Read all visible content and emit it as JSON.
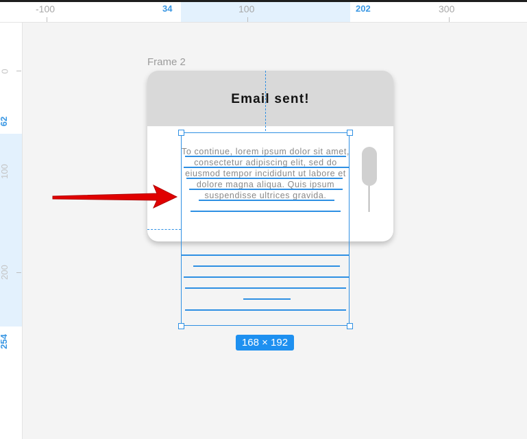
{
  "ruler_top": {
    "ticks": [
      "-100",
      "34",
      "100",
      "202",
      "300"
    ]
  },
  "ruler_left": {
    "ticks": [
      "0",
      "62",
      "100",
      "200",
      "254"
    ]
  },
  "frame": {
    "title": "Frame 2"
  },
  "modal": {
    "heading": "Email sent!",
    "body": "To continue, lorem ipsum dolor sit amet, consectetur adipiscing elit, sed do eiusmod tempor incididunt ut labore et dolore magna aliqua. Quis ipsum suspendisse ultrices gravida."
  },
  "selection": {
    "dimensions": "168 × 192"
  },
  "colors": {
    "accent": "#2d8fe3",
    "ruler_highlight": "#e3f1fd",
    "canvas": "#f4f4f4",
    "header": "#d9d9d9",
    "arrow": "#e00000"
  },
  "icons": {
    "annotation": "red-arrow-icon"
  }
}
